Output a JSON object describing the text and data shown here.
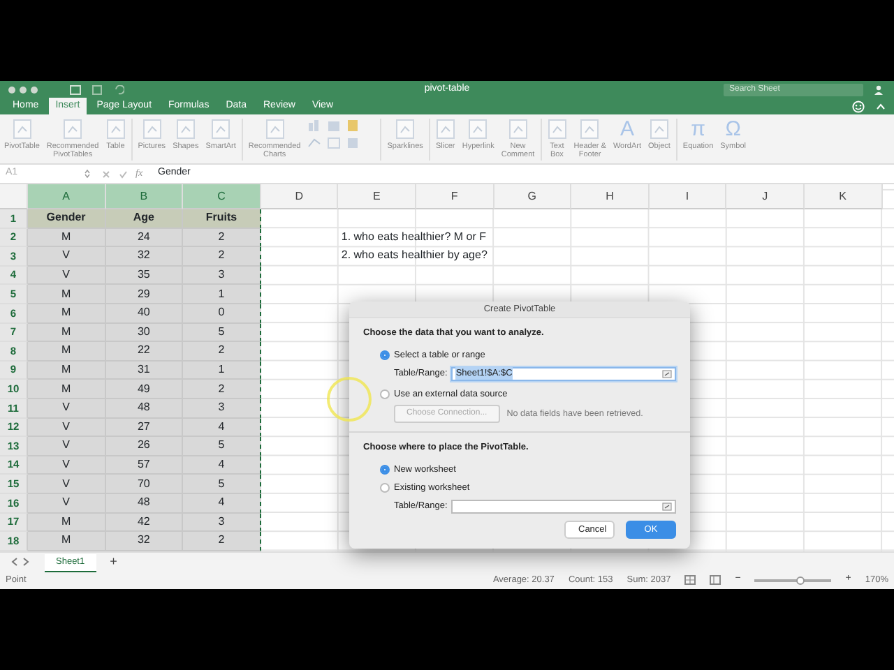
{
  "window": {
    "title": "pivot-table",
    "search": {
      "placeholder": "Search Sheet"
    }
  },
  "ribbon_tabs": [
    {
      "label": "Home",
      "selected": false
    },
    {
      "label": "Insert",
      "selected": true
    },
    {
      "label": "Page Layout",
      "selected": false
    },
    {
      "label": "Formulas",
      "selected": false
    },
    {
      "label": "Data",
      "selected": false
    },
    {
      "label": "Review",
      "selected": false
    },
    {
      "label": "View",
      "selected": false
    }
  ],
  "ribbon": [
    {
      "kind": "button",
      "label": "PivotTable"
    },
    {
      "kind": "button",
      "label": "Recommended\nPivotTables"
    },
    {
      "kind": "button",
      "label": "Table"
    },
    {
      "kind": "separator"
    },
    {
      "kind": "button",
      "label": "Pictures"
    },
    {
      "kind": "button",
      "label": "Shapes"
    },
    {
      "kind": "button",
      "label": "SmartArt"
    },
    {
      "kind": "separator"
    },
    {
      "kind": "button",
      "label": "Recommended\nCharts"
    },
    {
      "kind": "charts"
    },
    {
      "kind": "separator"
    },
    {
      "kind": "button",
      "label": "Sparklines"
    },
    {
      "kind": "separator"
    },
    {
      "kind": "button",
      "label": "Slicer"
    },
    {
      "kind": "button",
      "label": "Hyperlink"
    },
    {
      "kind": "button",
      "label": "New\nComment"
    },
    {
      "kind": "separator"
    },
    {
      "kind": "button",
      "label": "Text\nBox"
    },
    {
      "kind": "button",
      "label": "Header &\nFooter"
    },
    {
      "kind": "glyph",
      "glyph": "A",
      "label": "WordArt"
    },
    {
      "kind": "button",
      "label": "Object"
    },
    {
      "kind": "separator"
    },
    {
      "kind": "glyph",
      "glyph": "π",
      "label": "Equation"
    },
    {
      "kind": "glyph",
      "glyph": "Ω",
      "label": "Symbol"
    }
  ],
  "formula_bar": {
    "name_box": "A1",
    "fx": "fx",
    "value": "Gender"
  },
  "columns": [
    {
      "letter": "A",
      "selected": true
    },
    {
      "letter": "B",
      "selected": true
    },
    {
      "letter": "C",
      "selected": true
    },
    {
      "letter": "D",
      "selected": false
    },
    {
      "letter": "E",
      "selected": false
    },
    {
      "letter": "F",
      "selected": false
    },
    {
      "letter": "G",
      "selected": false
    },
    {
      "letter": "H",
      "selected": false
    },
    {
      "letter": "I",
      "selected": false
    },
    {
      "letter": "J",
      "selected": false
    },
    {
      "letter": "K",
      "selected": false
    }
  ],
  "rows": [
    {
      "number": "1",
      "kind": "header",
      "cells": [
        "Gender",
        "Age",
        "Fruits"
      ]
    },
    {
      "number": "2",
      "kind": "data",
      "cells": [
        "M",
        "24",
        "2"
      ],
      "column_e": "1. who eats healthier? M or F"
    },
    {
      "number": "3",
      "kind": "data",
      "cells": [
        "V",
        "32",
        "2"
      ],
      "column_e": "2. who eats healthier by age?"
    },
    {
      "number": "4",
      "kind": "data",
      "cells": [
        "V",
        "35",
        "3"
      ]
    },
    {
      "number": "5",
      "kind": "data",
      "cells": [
        "M",
        "29",
        "1"
      ]
    },
    {
      "number": "6",
      "kind": "data",
      "cells": [
        "M",
        "40",
        "0"
      ]
    },
    {
      "number": "7",
      "kind": "data",
      "cells": [
        "M",
        "30",
        "5"
      ]
    },
    {
      "number": "8",
      "kind": "data",
      "cells": [
        "M",
        "22",
        "2"
      ]
    },
    {
      "number": "9",
      "kind": "data",
      "cells": [
        "M",
        "31",
        "1"
      ]
    },
    {
      "number": "10",
      "kind": "data",
      "cells": [
        "M",
        "49",
        "2"
      ]
    },
    {
      "number": "11",
      "kind": "data",
      "cells": [
        "V",
        "48",
        "3"
      ]
    },
    {
      "number": "12",
      "kind": "data",
      "cells": [
        "V",
        "27",
        "4"
      ]
    },
    {
      "number": "13",
      "kind": "data",
      "cells": [
        "V",
        "26",
        "5"
      ]
    },
    {
      "number": "14",
      "kind": "data",
      "cells": [
        "V",
        "57",
        "4"
      ]
    },
    {
      "number": "15",
      "kind": "data",
      "cells": [
        "V",
        "70",
        "5"
      ]
    },
    {
      "number": "16",
      "kind": "data",
      "cells": [
        "V",
        "48",
        "4"
      ]
    },
    {
      "number": "17",
      "kind": "data",
      "cells": [
        "M",
        "42",
        "3"
      ]
    },
    {
      "number": "18",
      "kind": "data",
      "cells": [
        "M",
        "32",
        "2"
      ]
    }
  ],
  "sheet_tabs": [
    {
      "label": "Sheet1",
      "selected": true
    }
  ],
  "add_sheet": "+",
  "status_bar": {
    "mode": "Point",
    "average": "Average: 20.37",
    "count": "Count: 153",
    "sum": "Sum: 2037",
    "zoom_out": "−",
    "zoom_in": "+",
    "zoom": "170%",
    "zoom_slider": {
      "level": 0.6
    }
  },
  "dialog": {
    "title": "Create PivotTable",
    "section_1": {
      "heading": "Choose the data that you want to analyze.",
      "options": [
        {
          "label": "Select a table or range",
          "selected": true
        },
        {
          "label": "Use an external data source",
          "selected": false
        }
      ],
      "range_label": "Table/Range:",
      "range_value": "Sheet1!$A:$C",
      "connection_button": {
        "label": "Choose Connection...",
        "disabled": true
      },
      "connection_note": "No data fields have been retrieved."
    },
    "section_2": {
      "heading": "Choose where to place the PivotTable.",
      "options": [
        {
          "label": "New worksheet",
          "selected": true
        },
        {
          "label": "Existing worksheet",
          "selected": false
        }
      ],
      "range_label": "Table/Range:"
    },
    "buttons": [
      {
        "label": "Cancel",
        "kind": "default"
      },
      {
        "label": "OK",
        "kind": "primary"
      }
    ]
  }
}
